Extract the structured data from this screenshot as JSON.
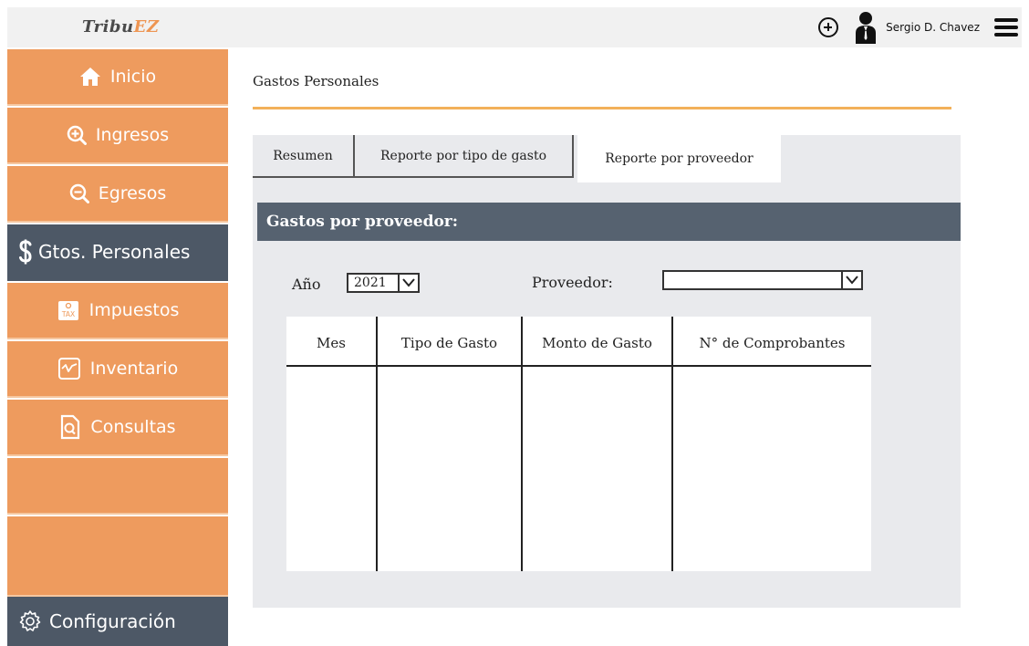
{
  "app": {
    "logo_main": "Tribu",
    "logo_accent": "EZ",
    "user_name": "Sergio D. Chavez"
  },
  "sidebar": {
    "items": [
      {
        "label": "Inicio",
        "icon": "home-icon"
      },
      {
        "label": "Ingresos",
        "icon": "zoom-in-icon"
      },
      {
        "label": "Egresos",
        "icon": "zoom-out-icon"
      },
      {
        "label": "Gtos. Personales",
        "icon": "dollar-icon",
        "active": true
      },
      {
        "label": "Impuestos",
        "icon": "tax-icon"
      },
      {
        "label": "Inventario",
        "icon": "chart-icon"
      },
      {
        "label": "Consultas",
        "icon": "document-search-icon"
      }
    ],
    "config_label": "Configuración"
  },
  "main": {
    "page_title": "Gastos Personales",
    "tabs": [
      {
        "label": "Resumen"
      },
      {
        "label": "Reporte por tipo de gasto"
      },
      {
        "label": "Reporte por proveedor",
        "active": true
      }
    ],
    "section_title": "Gastos por proveedor:",
    "filters": {
      "year_label": "Año",
      "year_value": "2021",
      "provider_label": "Proveedor:",
      "provider_value": ""
    },
    "table": {
      "columns": [
        "Mes",
        "Tipo de Gasto",
        "Monto de Gasto",
        "N° de Comprobantes"
      ]
    }
  },
  "colors": {
    "accent_orange": "#ee9b5e",
    "dark_slate": "#4d5866",
    "rule_orange": "#f3b15a",
    "panel_bg": "#e9eaed"
  }
}
